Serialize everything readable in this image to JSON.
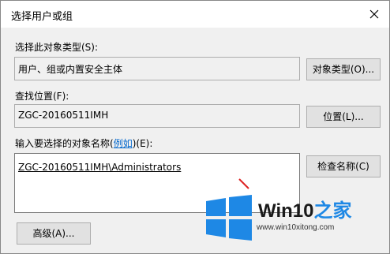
{
  "dialog": {
    "title": "选择用户或组"
  },
  "object_type": {
    "label": "选择此对象类型(S):",
    "value": "用户、组或内置安全主体",
    "button_label": "对象类型(O)..."
  },
  "location": {
    "label": "查找位置(F):",
    "value": "ZGC-20160511IMH",
    "button_label": "位置(L)..."
  },
  "object_names": {
    "label_prefix": "输入要选择的对象名称(",
    "label_link": "例如",
    "label_suffix": ")(E):",
    "value": "ZGC-20160511IMH\\Administrators",
    "check_button_label": "检查名称(C)"
  },
  "advanced": {
    "button_label": "高级(A)..."
  },
  "watermark": {
    "brand_win": "Win10",
    "brand_zh": "之家",
    "url": "www.win10xitong.com",
    "logo_color": "#1e88e5"
  }
}
